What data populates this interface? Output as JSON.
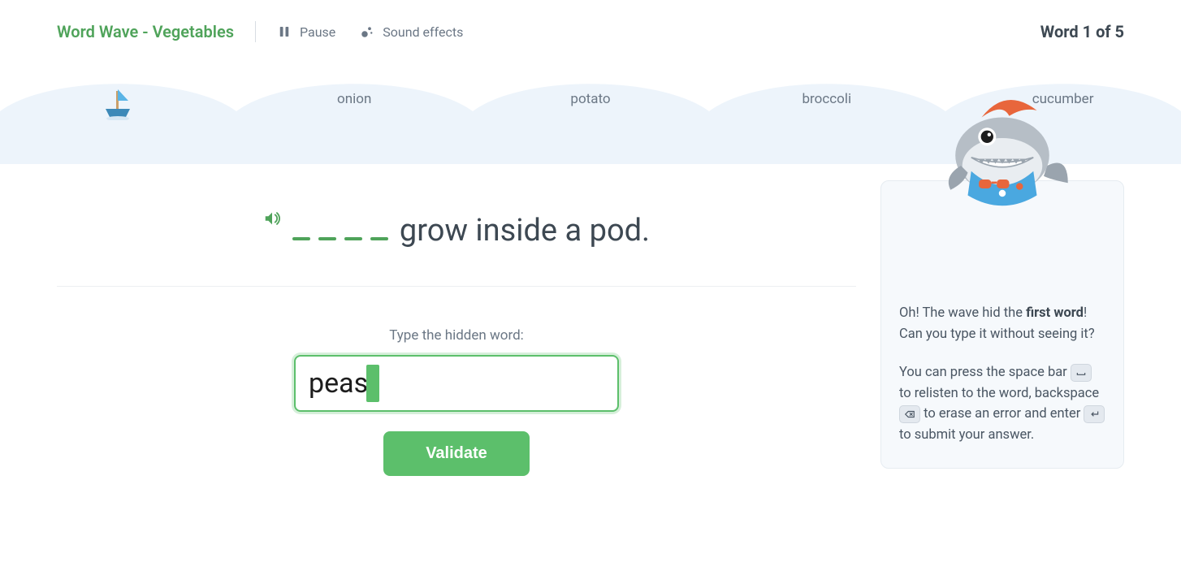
{
  "header": {
    "title": "Word Wave - Vegetables",
    "pause_label": "Pause",
    "sound_label": "Sound effects",
    "progress_label": "Word 1 of 5"
  },
  "wave": {
    "current_index": 0,
    "words": [
      "",
      "onion",
      "potato",
      "broccoli",
      "cucumber"
    ]
  },
  "question": {
    "blank_length": 4,
    "sentence_rest": "grow inside a pod.",
    "prompt": "Type the hidden word:",
    "input_value": "peas",
    "validate_label": "Validate"
  },
  "hint": {
    "p1_pre": "Oh! The wave hid the ",
    "p1_bold": "first word",
    "p1_post": "! Can you type it without seeing it?",
    "p2_a": "You can press the space bar ",
    "p2_b": " to relisten to the word, backspace ",
    "p2_c": " to erase an error and enter ",
    "p2_d": " to submit your answer."
  },
  "icons": {
    "pause": "pause-icon",
    "sound": "sound-effects-icon",
    "audio": "audio-play-icon",
    "space_key": "space-key-icon",
    "backspace_key": "backspace-key-icon",
    "enter_key": "enter-key-icon",
    "boat": "boat-icon",
    "shark": "shark-mascot"
  }
}
